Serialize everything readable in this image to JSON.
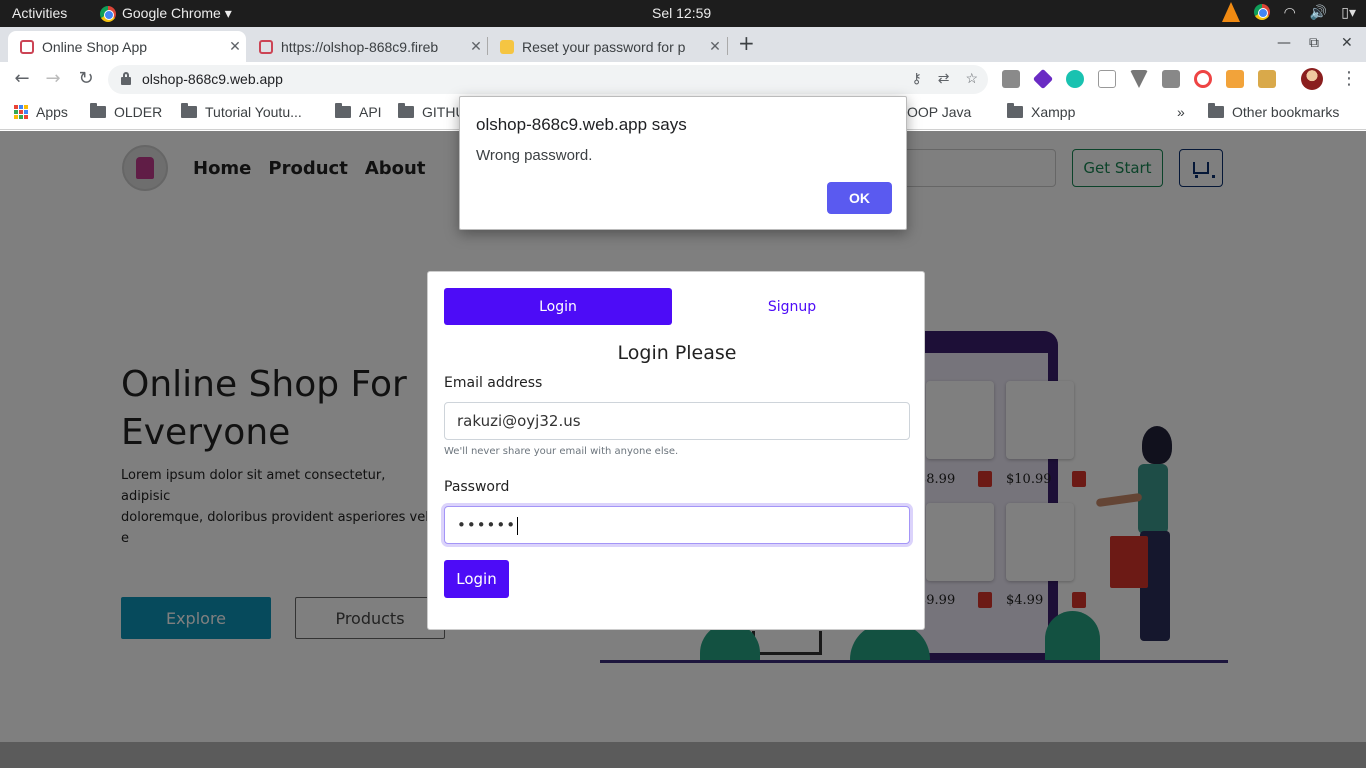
{
  "system_bar": {
    "activities": "Activities",
    "app_name": "Google Chrome ▾",
    "clock": "Sel 12:59"
  },
  "browser": {
    "tabs": [
      {
        "title": "Online Shop App",
        "active": true
      },
      {
        "title": "https://olshop-868c9.fireb",
        "active": false
      },
      {
        "title": "Reset your password for p",
        "active": false
      }
    ],
    "url": "olshop-868c9.web.app",
    "bookmarks": [
      "Apps",
      "OLDER",
      "Tutorial Youtu...",
      "API",
      "GITHU",
      "OOP Java",
      "Xampp"
    ],
    "bookmarks_overflow": "»",
    "other_bookmarks": "Other bookmarks"
  },
  "site": {
    "nav": [
      "Home",
      "Product",
      "About"
    ],
    "get_start": "Get Start",
    "hero_title": "Online Shop For Everyone",
    "hero_text": "Lorem ipsum dolor sit amet consectetur, adipisic\ndoloremque, doloribus provident asperiores vel e\nsunt aspernatur. Placeat veritatis in libero minus\nrepellendus iste non!",
    "explore": "Explore",
    "products": "Products",
    "prices": [
      "$8.99",
      "$10.99",
      "$9.99",
      "$4.99"
    ]
  },
  "login_modal": {
    "tab_login": "Login",
    "tab_signup": "Signup",
    "title": "Login Please",
    "email_label": "Email address",
    "email_value": "rakuzi@oyj32.us",
    "email_help": "We'll never share your email with anyone else.",
    "password_label": "Password",
    "password_value": "••••••",
    "submit": "Login"
  },
  "alert": {
    "title": "olshop-868c9.web.app says",
    "message": "Wrong password.",
    "ok": "OK"
  },
  "colors": {
    "primary": "#4d0cf7",
    "explore": "#0d94b8",
    "get_start": "#198754",
    "alert_ok": "#5a5af0"
  }
}
